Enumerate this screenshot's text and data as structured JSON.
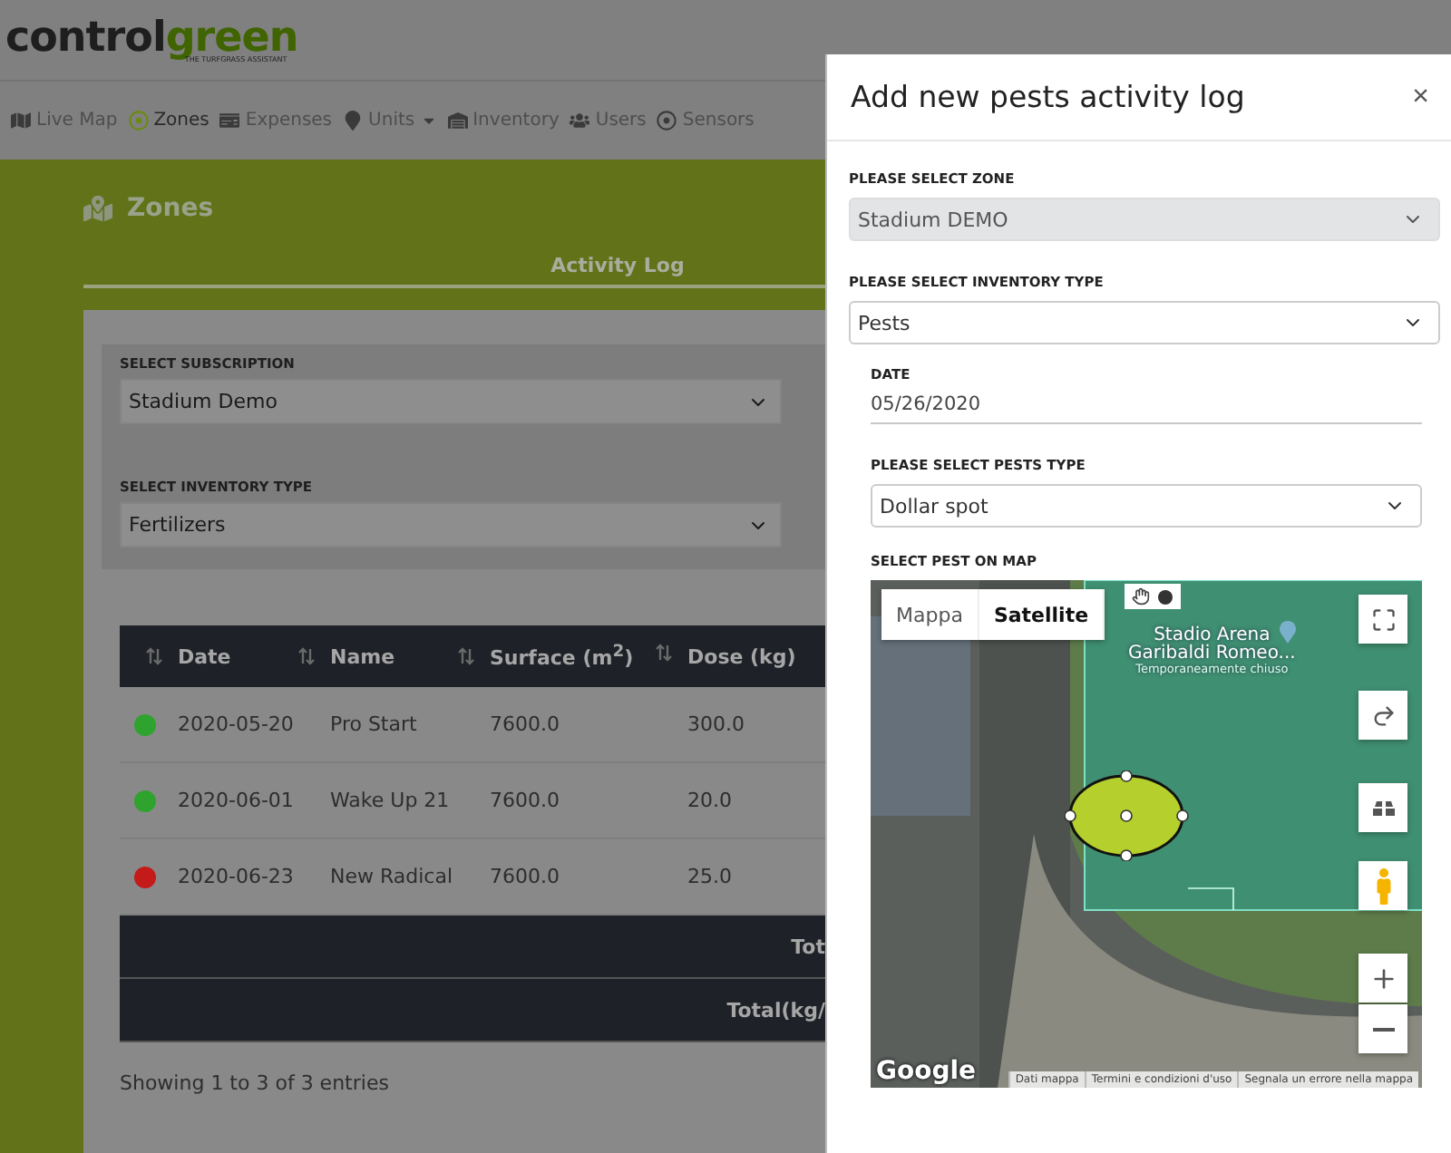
{
  "logo": {
    "primary": "control",
    "accent": "green",
    "tagline": "THE TURFGRASS ASSISTANT"
  },
  "nav": [
    {
      "label": "Live Map",
      "selected": false
    },
    {
      "label": "Zones",
      "selected": true
    },
    {
      "label": "Expenses",
      "selected": false
    },
    {
      "label": "Units",
      "selected": false,
      "dropdown": true
    },
    {
      "label": "Inventory",
      "selected": false
    },
    {
      "label": "Users",
      "selected": false
    },
    {
      "label": "Sensors",
      "selected": false
    }
  ],
  "page": {
    "title": "Zones",
    "tab": "Activity Log"
  },
  "filters": [
    {
      "label": "SELECT SUBSCRIPTION",
      "value": "Stadium Demo"
    },
    {
      "label": "SELECT INVENTORY TYPE",
      "value": "Fertilizers"
    }
  ],
  "table": {
    "columns": [
      "Date",
      "Name",
      "Surface (m$^{2}$)",
      "Dose (kg)"
    ],
    "rows": [
      {
        "color": "#2ea32e",
        "cells": [
          "2020-05-20",
          "Pro Start",
          "7600.0",
          "300.0"
        ]
      },
      {
        "color": "#2ea32e",
        "cells": [
          "2020-06-01",
          "Wake Up 21",
          "7600.0",
          "20.0"
        ]
      },
      {
        "color": "#c41a1a",
        "cells": [
          "2020-06-23",
          "New Radical",
          "7600.0",
          "25.0"
        ]
      }
    ],
    "totals": [
      "Tot",
      "Total(kg/"
    ],
    "footer": "Showing 1 to 3 of 3 entries"
  },
  "modal": {
    "title": "Add new pests activity log",
    "close": "×",
    "fields": [
      {
        "kind": "select",
        "label": "PLEASE SELECT ZONE",
        "value": "Stadium DEMO",
        "disabled": true
      },
      {
        "kind": "select",
        "label": "PLEASE SELECT INVENTORY TYPE",
        "value": "Pests",
        "disabled": false
      },
      {
        "kind": "date",
        "label": "DATE",
        "value": "05/26/2020"
      },
      {
        "kind": "select",
        "label": "PLEASE SELECT PESTS TYPE",
        "value": "Dollar spot",
        "disabled": false
      }
    ],
    "map": {
      "label": "SELECT PEST ON MAP",
      "types": [
        {
          "label": "Mappa",
          "selected": false
        },
        {
          "label": "Satellite",
          "selected": true
        }
      ],
      "place": [
        "Stadio Arena",
        "Garibaldi Romeo..."
      ],
      "place_note": "Temporaneamente chiuso",
      "brand": "Google",
      "links": [
        "Dati mappa",
        "Termini e condizioni d'uso",
        "Segnala un errore nella mappa"
      ]
    }
  }
}
